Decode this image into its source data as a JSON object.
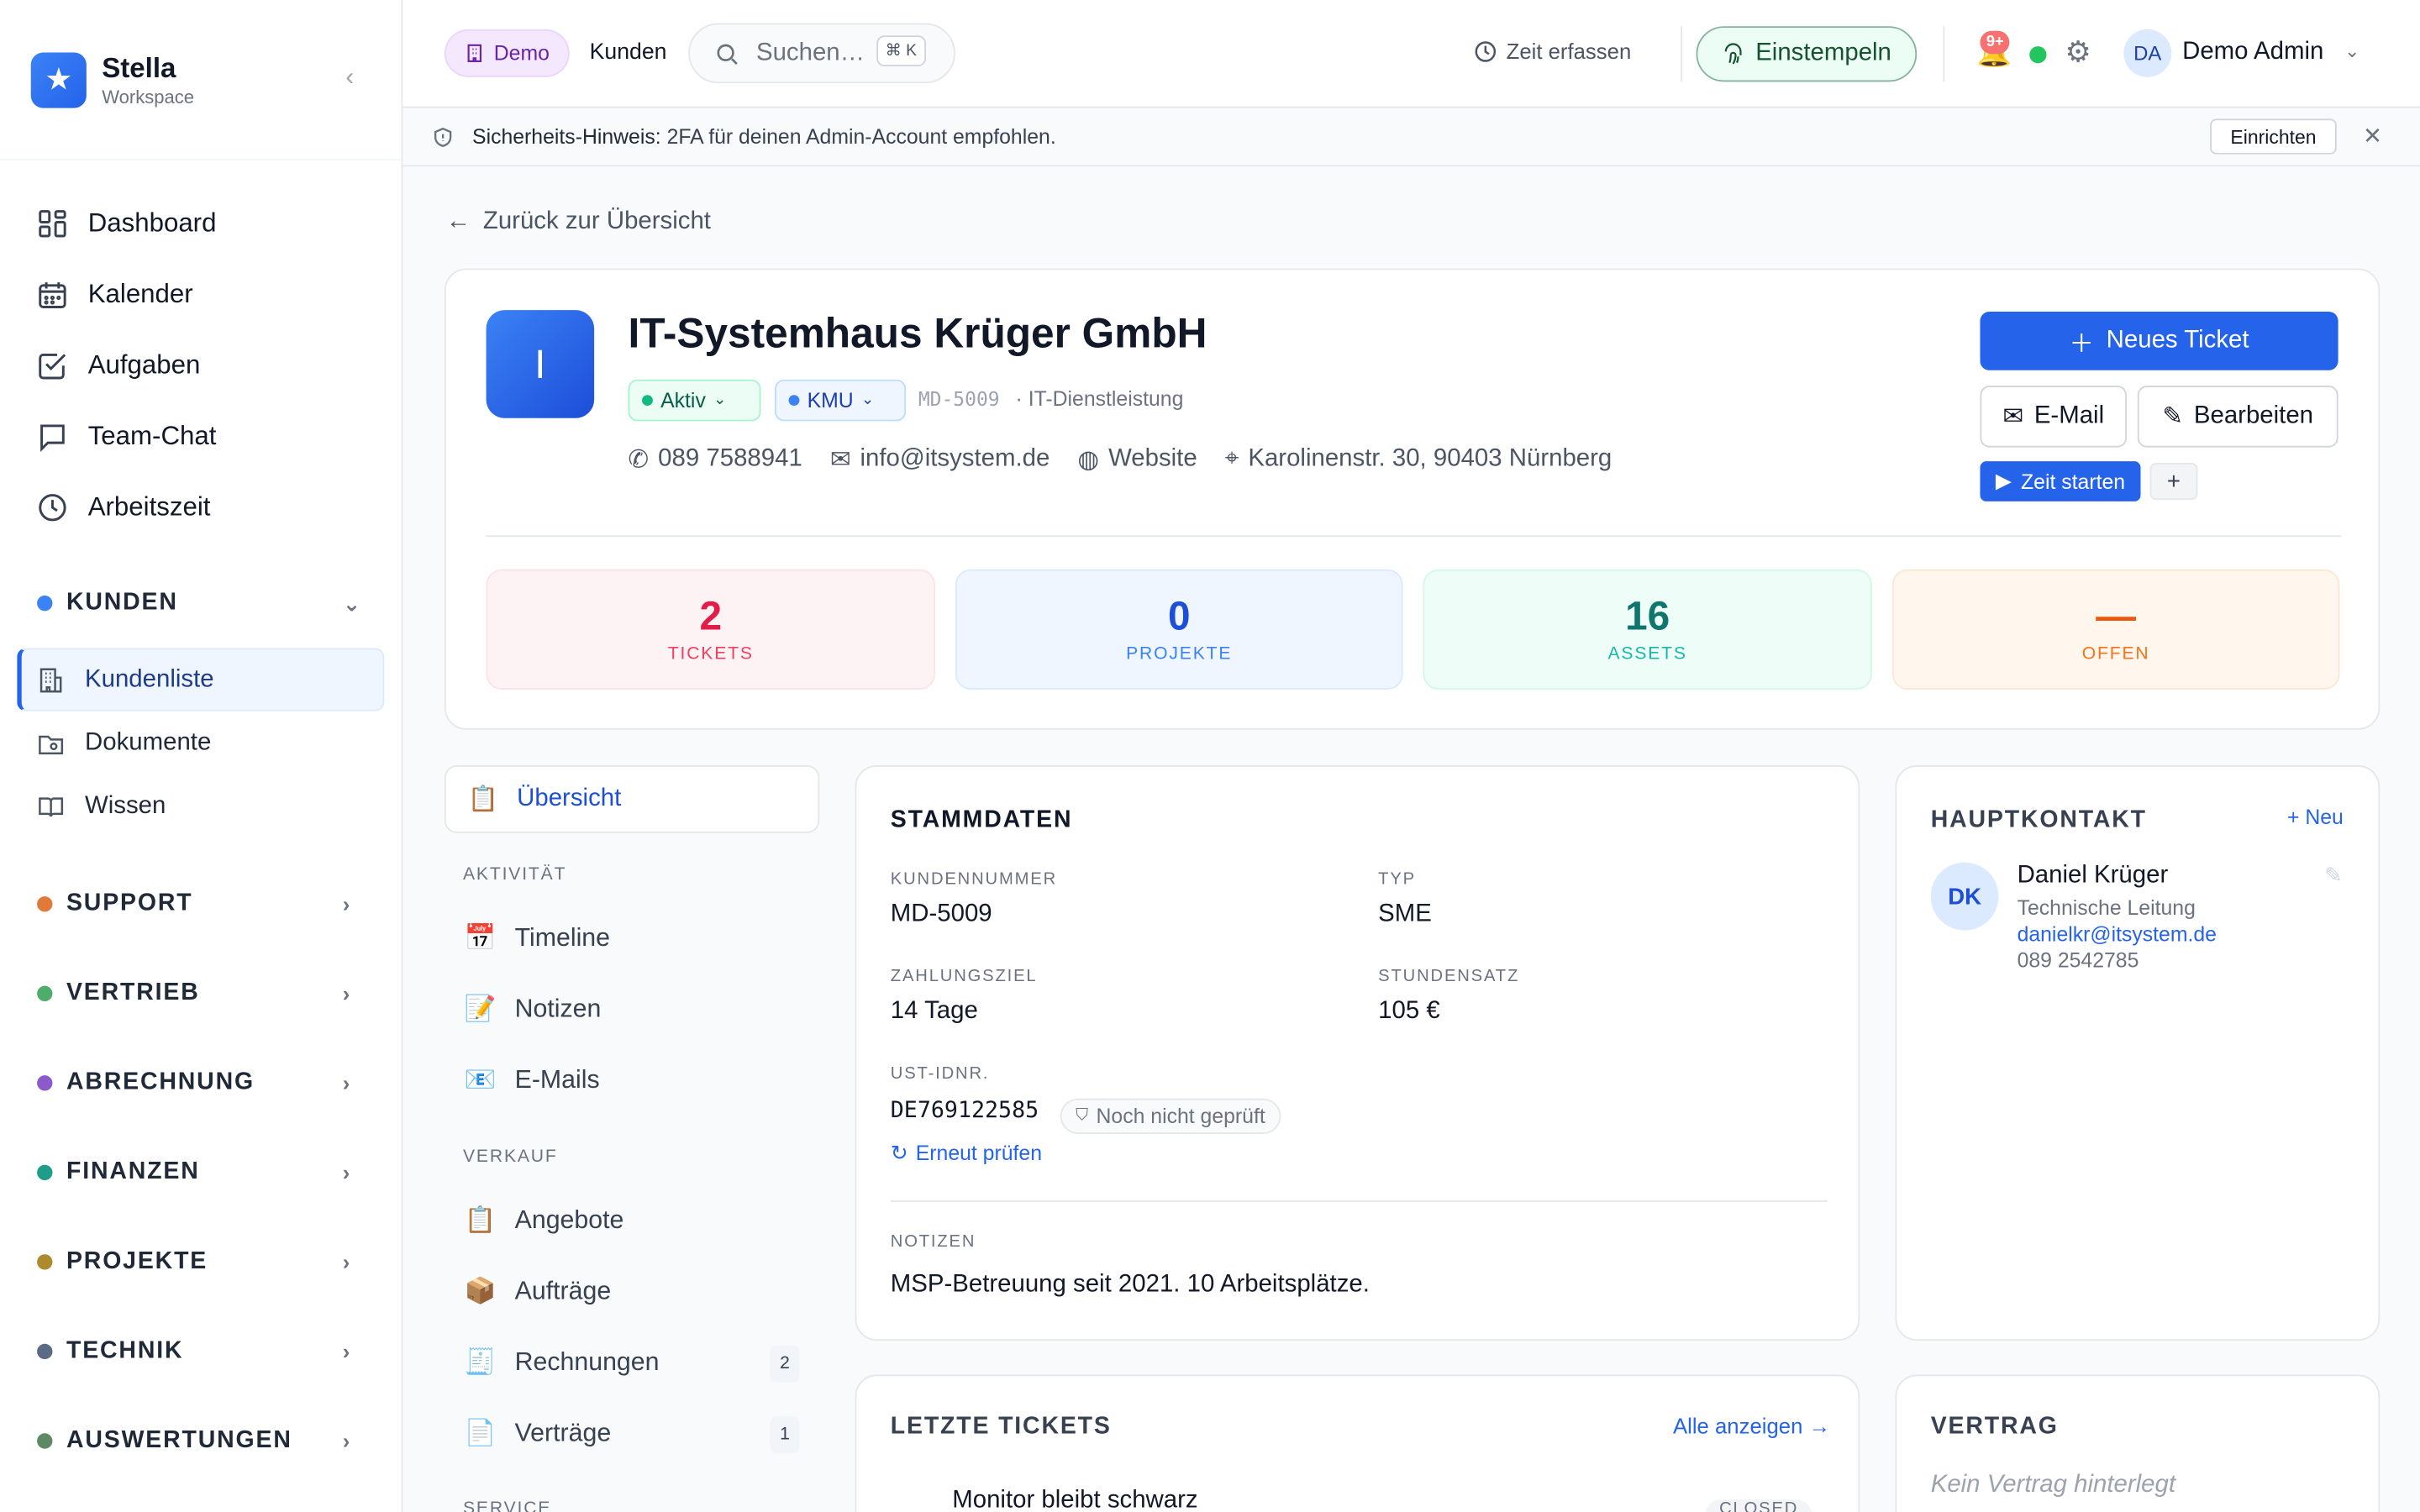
{
  "brand": {
    "name": "Stella",
    "sub": "Workspace"
  },
  "nav_main": [
    {
      "label": "Dashboard",
      "icon": "dashboard-icon"
    },
    {
      "label": "Kalender",
      "icon": "calendar-icon"
    },
    {
      "label": "Aufgaben",
      "icon": "checkbox-icon"
    },
    {
      "label": "Team-Chat",
      "icon": "chat-icon"
    },
    {
      "label": "Arbeitszeit",
      "icon": "clock-icon"
    }
  ],
  "sections": {
    "kunden": {
      "label": "KUNDEN",
      "color": "#3b82f6",
      "items": [
        "Kundenliste",
        "Dokumente",
        "Wissen"
      ]
    },
    "support": {
      "label": "SUPPORT",
      "color": "#ea580c"
    },
    "vertrieb": {
      "label": "VERTRIEB",
      "color": "#16a34a"
    },
    "abrechnung": {
      "label": "ABRECHNUNG",
      "color": "#7c3aed"
    },
    "finanzen": {
      "label": "FINANZEN",
      "color": "#0d9488"
    },
    "projekte": {
      "label": "PROJEKTE",
      "color": "#a16207"
    },
    "technik": {
      "label": "TECHNIK",
      "color": "#475569"
    },
    "auswertungen": {
      "label": "AUSWERTUNGEN",
      "color": "#15803d"
    }
  },
  "topbar": {
    "demo": "Demo",
    "kunden": "Kunden",
    "search_placeholder": "Suchen…",
    "search_kbd": "⌘ K",
    "zeit_erfassen": "Zeit erfassen",
    "einstempeln": "Einstempeln",
    "notif_count": "9+",
    "avatar": "DA",
    "user": "Demo Admin"
  },
  "notice": {
    "label": "Sicherheits-Hinweis:",
    "text": "2FA für deinen Admin-Account empfohlen.",
    "button": "Einrichten"
  },
  "back": "Zurück zur Übersicht",
  "customer": {
    "initial": "I",
    "name": "IT-Systemhaus Krüger GmbH",
    "status": "Aktiv",
    "segment": "KMU",
    "id": "MD-5009",
    "branche": "· IT-Dienstleistung",
    "phone": "089 7588941",
    "email": "info@itsystem.de",
    "website": "Website",
    "address": "Karolinenstr. 30, 90403 Nürnberg"
  },
  "actions": {
    "new_ticket": "Neues Ticket",
    "email": "E-Mail",
    "edit": "Bearbeiten",
    "start_time": "Zeit starten",
    "plus": "+"
  },
  "stats": [
    {
      "value": "2",
      "label": "TICKETS"
    },
    {
      "value": "0",
      "label": "PROJEKTE"
    },
    {
      "value": "16",
      "label": "ASSETS"
    },
    {
      "value": "—",
      "label": "OFFEN"
    }
  ],
  "tabs": {
    "active": "Übersicht",
    "group_aktivitaet": "AKTIVITÄT",
    "timeline": "Timeline",
    "notizen": "Notizen",
    "emails": "E-Mails",
    "group_verkauf": "VERKAUF",
    "angebote": "Angebote",
    "auftraege": "Aufträge",
    "rechnungen": "Rechnungen",
    "rechnungen_count": "2",
    "vertraege": "Verträge",
    "vertraege_count": "1",
    "group_service": "SERVICE"
  },
  "stammdaten": {
    "title": "STAMMDATEN",
    "kundennummer_label": "KUNDENNUMMER",
    "kundennummer": "MD-5009",
    "typ_label": "TYP",
    "typ": "SME",
    "zahlungsziel_label": "ZAHLUNGSZIEL",
    "zahlungsziel": "14 Tage",
    "stundensatz_label": "STUNDENSATZ",
    "stundensatz": "105 €",
    "ust_label": "UST-IDNR.",
    "ust": "DE769122585",
    "ust_status": "Noch nicht geprüft",
    "recheck": "Erneut prüfen",
    "notizen_label": "NOTIZEN",
    "notizen": "MSP-Betreuung seit 2021. 10 Arbeitsplätze."
  },
  "hauptkontakt": {
    "title": "HAUPTKONTAKT",
    "neu": "+ Neu",
    "initials": "DK",
    "name": "Daniel Krüger",
    "role": "Technische Leitung",
    "email": "danielkr@itsystem.de",
    "phone": "089 2542785"
  },
  "tickets": {
    "title": "LETZTE TICKETS",
    "all": "Alle anzeigen →",
    "first": "Monitor bleibt schwarz",
    "first_status": "CLOSED"
  },
  "vertrag": {
    "title": "VERTRAG",
    "empty": "Kein Vertrag hinterlegt"
  }
}
